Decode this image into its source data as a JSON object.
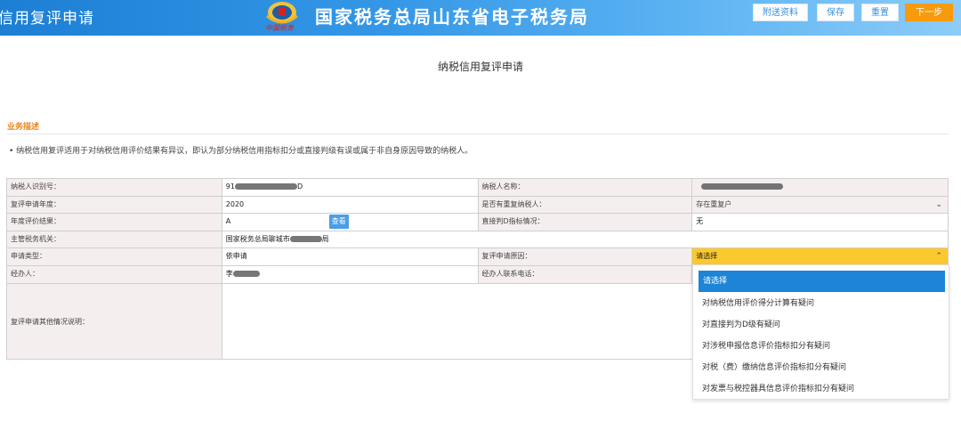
{
  "header": {
    "app_title": "信用复评申请",
    "emblem_text": "中国税务",
    "bureau_name": "国家税务总局山东省电子税务局",
    "buttons": {
      "attach": "附送资料",
      "save": "保存",
      "reset": "重置",
      "next": "下一步"
    },
    "accent_color": "#f79a0c"
  },
  "page_title": "纳税信用复评申请",
  "section": {
    "heading": "业务描述",
    "description": "• 纳税信用复评适用于对纳税信用评价结果有异议，即认为部分纳税信用指标扣分或直接判级有误或属于非自身原因导致的纳税人。"
  },
  "form": {
    "taxpayer_id": {
      "label": "纳税人识别号：",
      "prefix": "91",
      "suffix": "D"
    },
    "taxpayer_name": {
      "label": "纳税人名称："
    },
    "year": {
      "label": "复评申请年度：",
      "value": "2020"
    },
    "reconcile": {
      "label": "是否有重复纳税人：",
      "value": "存在重复户"
    },
    "result": {
      "label": "年度评价结果：",
      "value": "A",
      "view_button": "查看"
    },
    "direct_d": {
      "label": "直接判D指标情况：",
      "value": "无"
    },
    "authority": {
      "label": "主管税务机关：",
      "prefix": "国家税务总局聊城市",
      "suffix": "局"
    },
    "apply_type": {
      "label": "申请类型：",
      "value": "依申请"
    },
    "reason": {
      "label": "复评申请原因：",
      "value": "请选择"
    },
    "handler": {
      "label": "经办人：",
      "prefix": "李"
    },
    "phone": {
      "label": "经办人联系电话："
    },
    "notes": {
      "label": "复评申请其他情况说明："
    }
  },
  "reason_options": [
    "请选择",
    "对纳税信用评价得分计算有疑问",
    "对直接判为D级有疑问",
    "对涉税申报信息评价指标扣分有疑问",
    "对税（费）缴纳信息评价指标扣分有疑问",
    "对发票与税控器具信息评价指标扣分有疑问"
  ],
  "icons": {
    "emblem": "tax-emblem-icon",
    "chevron_down": "chevron-down-icon",
    "chevron_up": "chevron-up-icon"
  },
  "colors": {
    "header_start": "#1c7fd4",
    "selected_field": "#fbc92e",
    "selected_option": "#1e84d6",
    "label_bg": "#f5eeee",
    "section_heading": "#e8861b"
  }
}
